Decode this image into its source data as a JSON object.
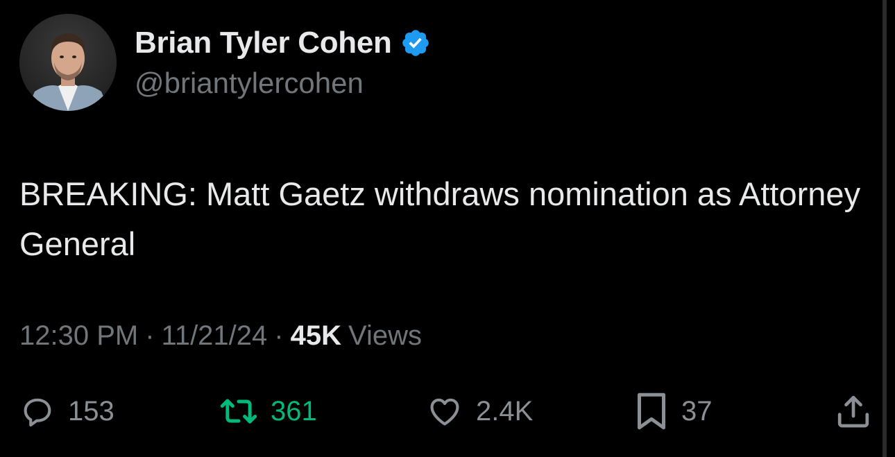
{
  "author": {
    "display_name": "Brian Tyler Cohen",
    "handle": "@briantylercohen",
    "verified_icon": "verified-badge-icon",
    "verified_color": "#1d9bf0"
  },
  "tweet": {
    "text": "BREAKING: Matt Gaetz withdraws nomination as Attorney General"
  },
  "meta": {
    "time": "12:30 PM",
    "separator": "·",
    "date": "11/21/24",
    "views_count": "45K",
    "views_label": "Views"
  },
  "actions": {
    "reply": {
      "icon": "reply-icon",
      "count": "153"
    },
    "retweet": {
      "icon": "retweet-icon",
      "count": "361",
      "color": "#00ba7c"
    },
    "like": {
      "icon": "heart-icon",
      "count": "2.4K"
    },
    "bookmark": {
      "icon": "bookmark-icon",
      "count": "37"
    },
    "share": {
      "icon": "share-icon"
    }
  },
  "colors": {
    "background": "#000000",
    "text_primary": "#e7e9ea",
    "text_secondary": "#71767b",
    "retweet_active": "#00ba7c"
  }
}
